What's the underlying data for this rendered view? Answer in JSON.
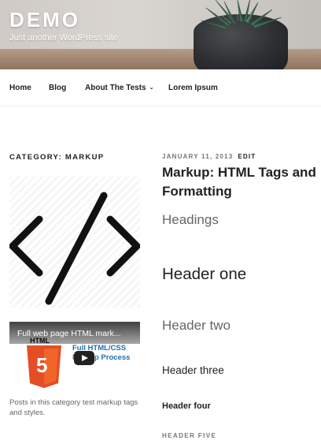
{
  "header": {
    "site_title": "DEMO",
    "site_description": "Just another WordPress site"
  },
  "nav": {
    "items": [
      {
        "label": "Home"
      },
      {
        "label": "Blog"
      },
      {
        "label": "About The Tests"
      },
      {
        "label": "Lorem Ipsum"
      }
    ]
  },
  "sidebar": {
    "category_title": "CATEGORY: MARKUP",
    "category_image_icon": "code-brackets-icon",
    "video": {
      "title": "Full web page HTML mark...",
      "overlay_text": "Full HTML/CSS Markup Process",
      "badge_icon": "html5-icon"
    },
    "category_description": "Posts in this category test markup tags and styles."
  },
  "post": {
    "date": "JANUARY 11, 2013",
    "edit_label": "EDIT",
    "title": "Markup: HTML Tags and Formatting",
    "section_heading": "Headings",
    "h1": "Header one",
    "h2": "Header two",
    "h3": "Header three",
    "h4": "Header four",
    "h5": "HEADER FIVE"
  },
  "colors": {
    "text_dark": "#222222",
    "text_muted": "#767676",
    "video_link": "#1f6fb2",
    "html5_orange": "#e44d26"
  }
}
